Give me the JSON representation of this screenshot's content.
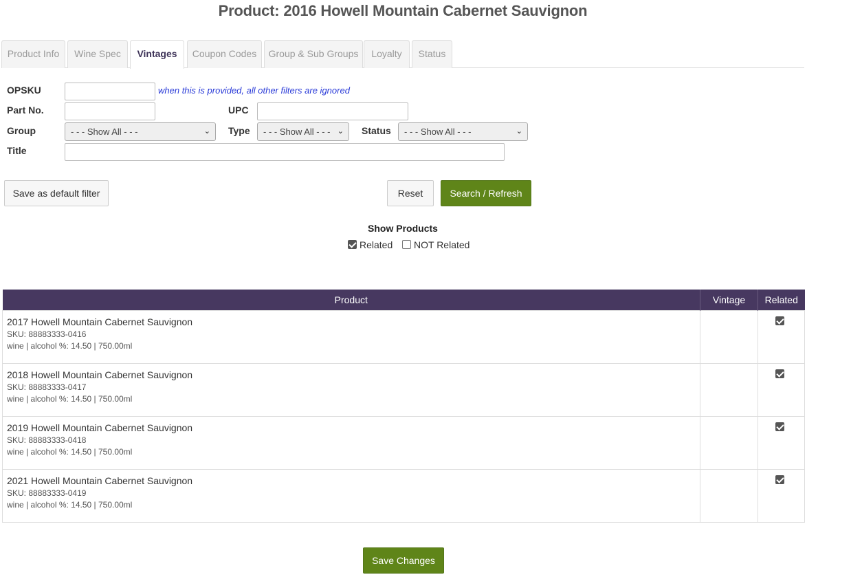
{
  "page_title": "Product: 2016 Howell Mountain Cabernet Sauvignon",
  "tabs": [
    {
      "label": "Product Info",
      "active": false
    },
    {
      "label": "Wine Spec",
      "active": false
    },
    {
      "label": "Vintages",
      "active": true
    },
    {
      "label": "Coupon Codes",
      "active": false
    },
    {
      "label": "Group & Sub Groups",
      "active": false
    },
    {
      "label": "Loyalty",
      "active": false
    },
    {
      "label": "Status",
      "active": false
    }
  ],
  "filters": {
    "opsku_label": "OPSKU",
    "opsku_value": "",
    "opsku_hint": "when this is provided, all other filters are ignored",
    "partno_label": "Part No.",
    "partno_value": "",
    "upc_label": "UPC",
    "upc_value": "",
    "group_label": "Group",
    "group_selected": "- - - Show All - - -",
    "type_label": "Type",
    "type_selected": "- - - Show All - - -",
    "status_label": "Status",
    "status_selected": "- - - Show All - - -",
    "title_label": "Title",
    "title_value": ""
  },
  "buttons": {
    "save_default": "Save as default filter",
    "reset": "Reset",
    "search": "Search / Refresh",
    "save_changes": "Save Changes"
  },
  "show_products": {
    "title": "Show Products",
    "related_label": "Related",
    "related_checked": true,
    "not_related_label": "NOT Related",
    "not_related_checked": false
  },
  "table": {
    "headers": [
      "Product",
      "Vintage",
      "Related"
    ],
    "rows": [
      {
        "name": "2017 Howell Mountain Cabernet Sauvignon",
        "sku": "SKU: 88883333-0416",
        "spec": "wine | alcohol %: 14.50 | 750.00ml",
        "vintage": "",
        "related": true
      },
      {
        "name": "2018 Howell Mountain Cabernet Sauvignon",
        "sku": "SKU: 88883333-0417",
        "spec": "wine | alcohol %: 14.50 | 750.00ml",
        "vintage": "",
        "related": true
      },
      {
        "name": "2019 Howell Mountain Cabernet Sauvignon",
        "sku": "SKU: 88883333-0418",
        "spec": "wine | alcohol %: 14.50 | 750.00ml",
        "vintage": "",
        "related": true
      },
      {
        "name": "2021 Howell Mountain Cabernet Sauvignon",
        "sku": "SKU: 88883333-0419",
        "spec": "wine | alcohol %: 14.50 | 750.00ml",
        "vintage": "",
        "related": true
      }
    ]
  },
  "colors": {
    "header_purple": "#473860",
    "button_green": "#5f8519",
    "hint_blue": "#2a3bd8"
  },
  "icons": {
    "select_chevron": "chevron-down-icon",
    "checkbox": "checkbox-icon"
  }
}
